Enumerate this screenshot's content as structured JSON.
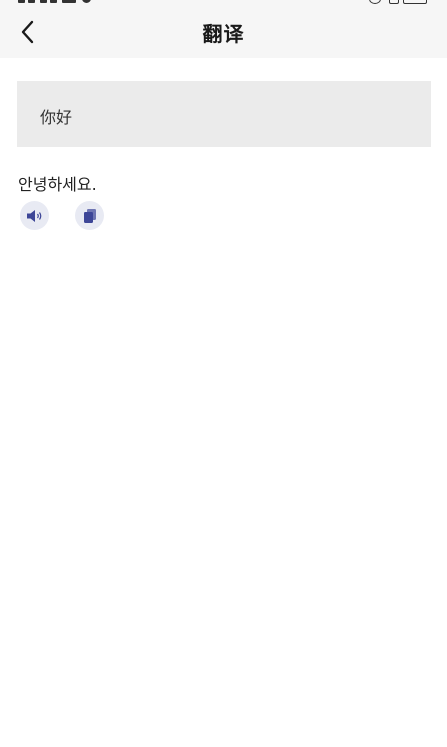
{
  "header": {
    "title": "翻译",
    "back_icon": "chevron-left-icon"
  },
  "source": {
    "text": "你好"
  },
  "result": {
    "text": "안녕하세요.",
    "actions": [
      {
        "icon": "speaker-icon"
      },
      {
        "icon": "copy-icon"
      }
    ]
  },
  "colors": {
    "header_bg": "#f6f6f6",
    "source_bg": "#ebebeb",
    "icon_bg": "#e8eaf3",
    "icon_fg": "#3d4697"
  }
}
